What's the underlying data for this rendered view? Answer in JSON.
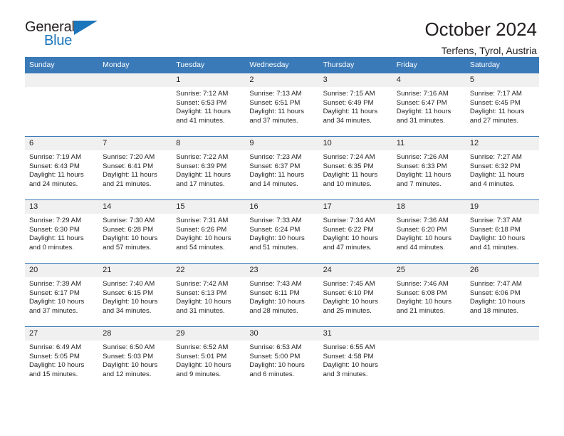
{
  "brand": {
    "name_top": "General",
    "name_bottom": "Blue",
    "triangle_color": "#1b75bb"
  },
  "header": {
    "title": "October 2024",
    "subtitle": "Terfens, Tyrol, Austria",
    "accent_color": "#3b7ab8",
    "daynum_band_color": "#f0f0f0"
  },
  "labels": {
    "sunrise_prefix": "Sunrise:",
    "sunset_prefix": "Sunset:",
    "daylight_prefix": "Daylight:"
  },
  "weekday_headers": [
    "Sunday",
    "Monday",
    "Tuesday",
    "Wednesday",
    "Thursday",
    "Friday",
    "Saturday"
  ],
  "weeks": [
    [
      {
        "day": "",
        "sunrise": "",
        "sunset": "",
        "daylight_line1": "",
        "daylight_line2": ""
      },
      {
        "day": "",
        "sunrise": "",
        "sunset": "",
        "daylight_line1": "",
        "daylight_line2": ""
      },
      {
        "day": "1",
        "sunrise": "Sunrise: 7:12 AM",
        "sunset": "Sunset: 6:53 PM",
        "daylight_line1": "Daylight: 11 hours",
        "daylight_line2": "and 41 minutes."
      },
      {
        "day": "2",
        "sunrise": "Sunrise: 7:13 AM",
        "sunset": "Sunset: 6:51 PM",
        "daylight_line1": "Daylight: 11 hours",
        "daylight_line2": "and 37 minutes."
      },
      {
        "day": "3",
        "sunrise": "Sunrise: 7:15 AM",
        "sunset": "Sunset: 6:49 PM",
        "daylight_line1": "Daylight: 11 hours",
        "daylight_line2": "and 34 minutes."
      },
      {
        "day": "4",
        "sunrise": "Sunrise: 7:16 AM",
        "sunset": "Sunset: 6:47 PM",
        "daylight_line1": "Daylight: 11 hours",
        "daylight_line2": "and 31 minutes."
      },
      {
        "day": "5",
        "sunrise": "Sunrise: 7:17 AM",
        "sunset": "Sunset: 6:45 PM",
        "daylight_line1": "Daylight: 11 hours",
        "daylight_line2": "and 27 minutes."
      }
    ],
    [
      {
        "day": "6",
        "sunrise": "Sunrise: 7:19 AM",
        "sunset": "Sunset: 6:43 PM",
        "daylight_line1": "Daylight: 11 hours",
        "daylight_line2": "and 24 minutes."
      },
      {
        "day": "7",
        "sunrise": "Sunrise: 7:20 AM",
        "sunset": "Sunset: 6:41 PM",
        "daylight_line1": "Daylight: 11 hours",
        "daylight_line2": "and 21 minutes."
      },
      {
        "day": "8",
        "sunrise": "Sunrise: 7:22 AM",
        "sunset": "Sunset: 6:39 PM",
        "daylight_line1": "Daylight: 11 hours",
        "daylight_line2": "and 17 minutes."
      },
      {
        "day": "9",
        "sunrise": "Sunrise: 7:23 AM",
        "sunset": "Sunset: 6:37 PM",
        "daylight_line1": "Daylight: 11 hours",
        "daylight_line2": "and 14 minutes."
      },
      {
        "day": "10",
        "sunrise": "Sunrise: 7:24 AM",
        "sunset": "Sunset: 6:35 PM",
        "daylight_line1": "Daylight: 11 hours",
        "daylight_line2": "and 10 minutes."
      },
      {
        "day": "11",
        "sunrise": "Sunrise: 7:26 AM",
        "sunset": "Sunset: 6:33 PM",
        "daylight_line1": "Daylight: 11 hours",
        "daylight_line2": "and 7 minutes."
      },
      {
        "day": "12",
        "sunrise": "Sunrise: 7:27 AM",
        "sunset": "Sunset: 6:32 PM",
        "daylight_line1": "Daylight: 11 hours",
        "daylight_line2": "and 4 minutes."
      }
    ],
    [
      {
        "day": "13",
        "sunrise": "Sunrise: 7:29 AM",
        "sunset": "Sunset: 6:30 PM",
        "daylight_line1": "Daylight: 11 hours",
        "daylight_line2": "and 0 minutes."
      },
      {
        "day": "14",
        "sunrise": "Sunrise: 7:30 AM",
        "sunset": "Sunset: 6:28 PM",
        "daylight_line1": "Daylight: 10 hours",
        "daylight_line2": "and 57 minutes."
      },
      {
        "day": "15",
        "sunrise": "Sunrise: 7:31 AM",
        "sunset": "Sunset: 6:26 PM",
        "daylight_line1": "Daylight: 10 hours",
        "daylight_line2": "and 54 minutes."
      },
      {
        "day": "16",
        "sunrise": "Sunrise: 7:33 AM",
        "sunset": "Sunset: 6:24 PM",
        "daylight_line1": "Daylight: 10 hours",
        "daylight_line2": "and 51 minutes."
      },
      {
        "day": "17",
        "sunrise": "Sunrise: 7:34 AM",
        "sunset": "Sunset: 6:22 PM",
        "daylight_line1": "Daylight: 10 hours",
        "daylight_line2": "and 47 minutes."
      },
      {
        "day": "18",
        "sunrise": "Sunrise: 7:36 AM",
        "sunset": "Sunset: 6:20 PM",
        "daylight_line1": "Daylight: 10 hours",
        "daylight_line2": "and 44 minutes."
      },
      {
        "day": "19",
        "sunrise": "Sunrise: 7:37 AM",
        "sunset": "Sunset: 6:18 PM",
        "daylight_line1": "Daylight: 10 hours",
        "daylight_line2": "and 41 minutes."
      }
    ],
    [
      {
        "day": "20",
        "sunrise": "Sunrise: 7:39 AM",
        "sunset": "Sunset: 6:17 PM",
        "daylight_line1": "Daylight: 10 hours",
        "daylight_line2": "and 37 minutes."
      },
      {
        "day": "21",
        "sunrise": "Sunrise: 7:40 AM",
        "sunset": "Sunset: 6:15 PM",
        "daylight_line1": "Daylight: 10 hours",
        "daylight_line2": "and 34 minutes."
      },
      {
        "day": "22",
        "sunrise": "Sunrise: 7:42 AM",
        "sunset": "Sunset: 6:13 PM",
        "daylight_line1": "Daylight: 10 hours",
        "daylight_line2": "and 31 minutes."
      },
      {
        "day": "23",
        "sunrise": "Sunrise: 7:43 AM",
        "sunset": "Sunset: 6:11 PM",
        "daylight_line1": "Daylight: 10 hours",
        "daylight_line2": "and 28 minutes."
      },
      {
        "day": "24",
        "sunrise": "Sunrise: 7:45 AM",
        "sunset": "Sunset: 6:10 PM",
        "daylight_line1": "Daylight: 10 hours",
        "daylight_line2": "and 25 minutes."
      },
      {
        "day": "25",
        "sunrise": "Sunrise: 7:46 AM",
        "sunset": "Sunset: 6:08 PM",
        "daylight_line1": "Daylight: 10 hours",
        "daylight_line2": "and 21 minutes."
      },
      {
        "day": "26",
        "sunrise": "Sunrise: 7:47 AM",
        "sunset": "Sunset: 6:06 PM",
        "daylight_line1": "Daylight: 10 hours",
        "daylight_line2": "and 18 minutes."
      }
    ],
    [
      {
        "day": "27",
        "sunrise": "Sunrise: 6:49 AM",
        "sunset": "Sunset: 5:05 PM",
        "daylight_line1": "Daylight: 10 hours",
        "daylight_line2": "and 15 minutes."
      },
      {
        "day": "28",
        "sunrise": "Sunrise: 6:50 AM",
        "sunset": "Sunset: 5:03 PM",
        "daylight_line1": "Daylight: 10 hours",
        "daylight_line2": "and 12 minutes."
      },
      {
        "day": "29",
        "sunrise": "Sunrise: 6:52 AM",
        "sunset": "Sunset: 5:01 PM",
        "daylight_line1": "Daylight: 10 hours",
        "daylight_line2": "and 9 minutes."
      },
      {
        "day": "30",
        "sunrise": "Sunrise: 6:53 AM",
        "sunset": "Sunset: 5:00 PM",
        "daylight_line1": "Daylight: 10 hours",
        "daylight_line2": "and 6 minutes."
      },
      {
        "day": "31",
        "sunrise": "Sunrise: 6:55 AM",
        "sunset": "Sunset: 4:58 PM",
        "daylight_line1": "Daylight: 10 hours",
        "daylight_line2": "and 3 minutes."
      },
      {
        "day": "",
        "sunrise": "",
        "sunset": "",
        "daylight_line1": "",
        "daylight_line2": ""
      },
      {
        "day": "",
        "sunrise": "",
        "sunset": "",
        "daylight_line1": "",
        "daylight_line2": ""
      }
    ]
  ]
}
